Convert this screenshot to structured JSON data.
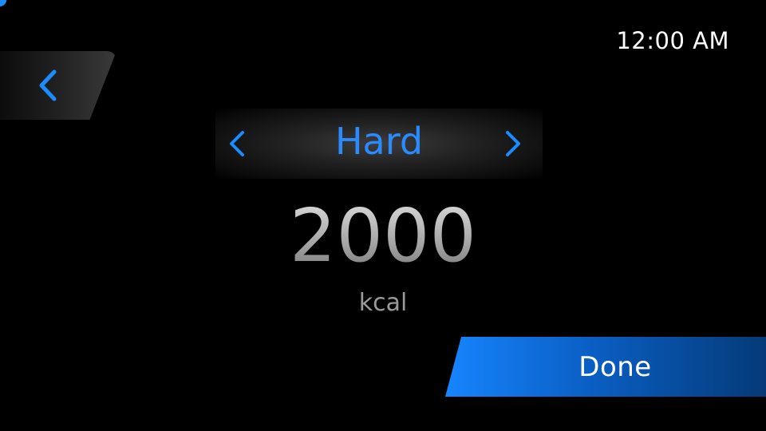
{
  "status_bar": {
    "time": "12:00 AM"
  },
  "navigation": {
    "back_icon": "chevron-left-icon"
  },
  "difficulty_selector": {
    "selected": "Hard",
    "prev_icon": "chevron-left-icon",
    "next_icon": "chevron-right-icon"
  },
  "goal": {
    "value": "2000",
    "unit": "kcal"
  },
  "actions": {
    "done_label": "Done"
  },
  "colors": {
    "accent": "#2a8bff",
    "background": "#000000",
    "done_gradient_start": "#1785ff",
    "done_gradient_end": "#053a78"
  }
}
